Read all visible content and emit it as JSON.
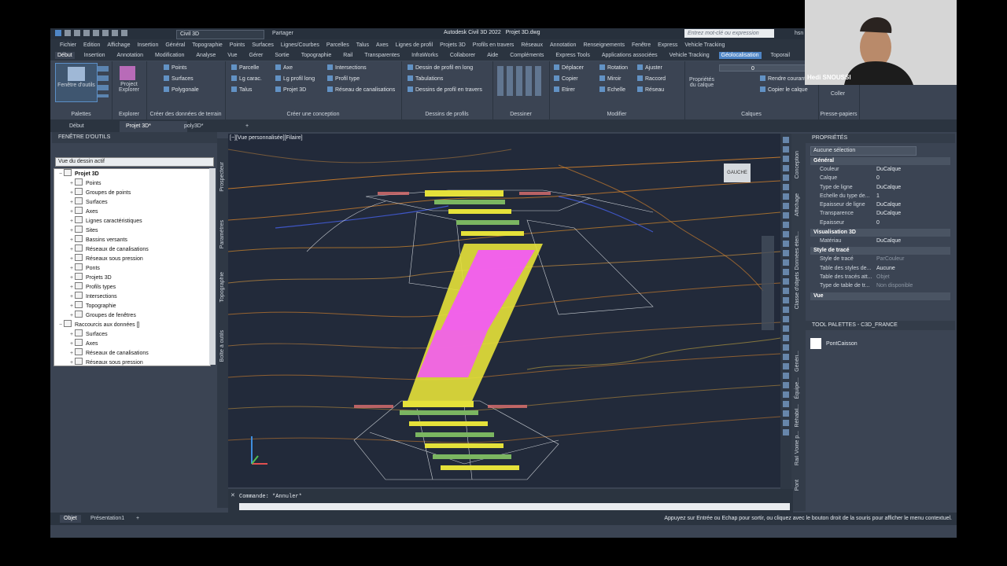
{
  "window": {
    "workspace": "Civil 3D",
    "share": "Partager",
    "app_title": "Autodesk Civil 3D 2022",
    "file_title": "Projet 3D.dwg",
    "search_placeholder": "Entrez mot-clé ou expression",
    "user": "hsn"
  },
  "menubar": [
    "Fichier",
    "Edition",
    "Affichage",
    "Insertion",
    "Général",
    "Topographie",
    "Points",
    "Surfaces",
    "Lignes/Courbes",
    "Parcelles",
    "Talus",
    "Axes",
    "Lignes de profil",
    "Projets 3D",
    "Profils en travers",
    "Réseaux",
    "Annotation",
    "Renseignements",
    "Fenêtre",
    "Express",
    "Vehicle Tracking"
  ],
  "ribbon_tabs": [
    "Début",
    "Insertion",
    "Annotation",
    "Modification",
    "Analyse",
    "Vue",
    "Gérer",
    "Sortie",
    "Topographie",
    "Rail",
    "Transparentes",
    "InfraWorks",
    "Collaborer",
    "Aide",
    "Compléments",
    "Express Tools",
    "Applications associées",
    "Vehicle Tracking",
    "Géolocalisation",
    "Toporail"
  ],
  "ribbon": {
    "palettes": {
      "label": "Palettes",
      "big": "Fenêtre d'outils"
    },
    "explorer": {
      "label": "Explorer",
      "big": "Project Explorer"
    },
    "terrain": {
      "label": "Créer des données de terrain",
      "items": [
        "Points",
        "Surfaces",
        "Polygonale"
      ]
    },
    "conception": {
      "label": "Créer une conception",
      "items": [
        "Parcelle",
        "Lg carac.",
        "Talus",
        "Axe",
        "Lg profil long",
        "Projet 3D",
        "Intersections",
        "Profil type",
        "Réseau de canalisations"
      ]
    },
    "profils": {
      "label": "Dessins de profils",
      "items": [
        "Dessin de profil en long",
        "Tabulations",
        "Dessins de profil en travers"
      ]
    },
    "dessiner": {
      "label": "Dessiner"
    },
    "modifier": {
      "label": "Modifier",
      "items": [
        "Déplacer",
        "Rotation",
        "Ajuster",
        "Copier",
        "Miroir",
        "Raccord",
        "Etirer",
        "Echelle",
        "Réseau"
      ]
    },
    "calques": {
      "label": "Calques",
      "layer": "0",
      "items": [
        "Propriétés du calque",
        "Rendre courant",
        "Copier le calque"
      ]
    },
    "presse": {
      "label": "Presse-papiers",
      "big": "Coller"
    }
  },
  "doc_tabs": [
    "Début",
    "Projet 3D*",
    "poly3D*"
  ],
  "toolspace": {
    "title": "FENÊTRE D'OUTILS",
    "view_select": "Vue du dessin actif",
    "tree": [
      {
        "label": "Projet 3D",
        "level": 0,
        "bold": true
      },
      {
        "label": "Points",
        "level": 1
      },
      {
        "label": "Groupes de points",
        "level": 1
      },
      {
        "label": "Surfaces",
        "level": 1
      },
      {
        "label": "Axes",
        "level": 1
      },
      {
        "label": "Lignes caractéristiques",
        "level": 1
      },
      {
        "label": "Sites",
        "level": 1
      },
      {
        "label": "Bassins versants",
        "level": 1
      },
      {
        "label": "Réseaux de canalisations",
        "level": 1
      },
      {
        "label": "Réseaux sous pression",
        "level": 1
      },
      {
        "label": "Ponts",
        "level": 1
      },
      {
        "label": "Projets 3D",
        "level": 1
      },
      {
        "label": "Profils types",
        "level": 1
      },
      {
        "label": "Intersections",
        "level": 1
      },
      {
        "label": "Topographie",
        "level": 1
      },
      {
        "label": "Groupes de fenêtres",
        "level": 1
      },
      {
        "label": "Raccourcis aux données []",
        "level": 0
      },
      {
        "label": "Surfaces",
        "level": 1
      },
      {
        "label": "Axes",
        "level": 1
      },
      {
        "label": "Réseaux de canalisations",
        "level": 1
      },
      {
        "label": "Réseaux sous pression",
        "level": 1
      }
    ],
    "side_tabs": [
      "Prospecteur",
      "Paramètres",
      "Topographie",
      "Boîte à outils"
    ]
  },
  "viewport": {
    "label": "[−][Vue personnalisée][Filaire]",
    "viewcube": "GAUCHE"
  },
  "properties": {
    "title": "PROPRIÉTÉS",
    "selection": "Aucune sélection",
    "sections": [
      {
        "name": "Général",
        "rows": [
          {
            "k": "Couleur",
            "v": "DuCalque"
          },
          {
            "k": "Calque",
            "v": "0"
          },
          {
            "k": "Type de ligne",
            "v": "DuCalque"
          },
          {
            "k": "Echelle du type de...",
            "v": "1"
          },
          {
            "k": "Epaisseur de ligne",
            "v": "DuCalque"
          },
          {
            "k": "Transparence",
            "v": "DuCalque"
          },
          {
            "k": "Epaisseur",
            "v": "0"
          }
        ]
      },
      {
        "name": "Visualisation 3D",
        "rows": [
          {
            "k": "Matériau",
            "v": "DuCalque"
          }
        ]
      },
      {
        "name": "Style de tracé",
        "rows": [
          {
            "k": "Style de tracé",
            "v": "ParCouleur",
            "dim": true
          },
          {
            "k": "Table des styles de...",
            "v": "Aucune"
          },
          {
            "k": "Table des tracés att...",
            "v": "Objet",
            "dim": true
          },
          {
            "k": "Type de table de tr...",
            "v": "Non disponible",
            "dim": true
          }
        ]
      },
      {
        "name": "Vue",
        "rows": []
      }
    ],
    "side_tabs": [
      "Conception",
      "Affichage",
      "Données éten...",
      "Classe d'objets"
    ]
  },
  "tool_palettes": {
    "title": "TOOL PALETTES - C3D_FRANCE",
    "item": "PontCaisson",
    "side_tabs": [
      "Généri...",
      "Équipe...",
      "Réhabil...",
      "Voirie p...",
      "Rail",
      "Pont"
    ]
  },
  "command": {
    "history": "Commande: *Annuler*"
  },
  "status": {
    "tabs": [
      "Objet",
      "Présentation1"
    ],
    "hint": "Appuyez sur Entrée ou Echap pour sortir, ou cliquez avec le bouton droit de la souris pour afficher le menu contextuel."
  },
  "webcam": {
    "name": "Hedi SNOUSSI"
  },
  "colors": {
    "pink": "#f25cf2",
    "yellow": "#e5e13a",
    "green": "#7bb661",
    "orange": "#e58a2b",
    "white": "#e8ecf0",
    "blue": "#3f56c6",
    "accent": "#4f86c6"
  }
}
